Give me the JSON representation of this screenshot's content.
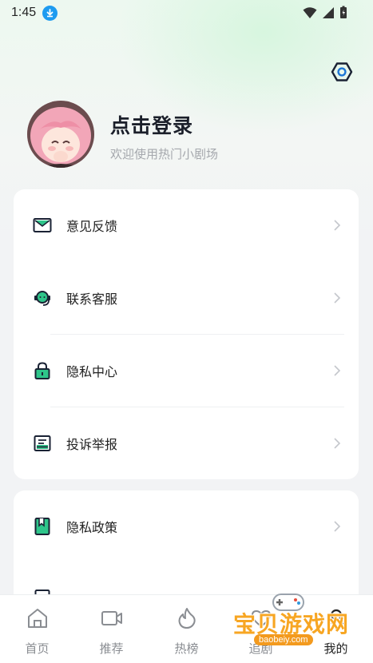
{
  "status_bar": {
    "time": "1:45"
  },
  "profile": {
    "title": "点击登录",
    "subtitle": "欢迎使用热门小剧场"
  },
  "menu_card_1": [
    {
      "label": "意见反馈",
      "icon": "mail-icon"
    },
    {
      "label": "联系客服",
      "icon": "headset-icon"
    },
    {
      "label": "隐私中心",
      "icon": "lock-icon"
    },
    {
      "label": "投诉举报",
      "icon": "report-icon"
    }
  ],
  "menu_card_2": [
    {
      "label": "隐私政策",
      "icon": "bookmark-doc-icon"
    }
  ],
  "tabbar": [
    {
      "label": "首页",
      "icon": "home-icon"
    },
    {
      "label": "推荐",
      "icon": "video-icon"
    },
    {
      "label": "热榜",
      "icon": "flame-icon"
    },
    {
      "label": "追剧",
      "icon": "heart-icon"
    },
    {
      "label": "我的",
      "icon": "user-icon",
      "active": true
    }
  ],
  "watermark": {
    "text": "宝贝游戏网",
    "url": "baobeiy.com"
  },
  "colors": {
    "accent": "#2ec58a",
    "settings_blue": "#1e77d6",
    "text_dark": "#1b1f2a",
    "watermark_orange": "#f7a623"
  }
}
